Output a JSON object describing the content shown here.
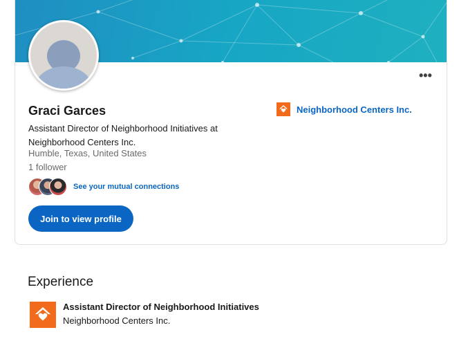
{
  "profile": {
    "name": "Graci Garces",
    "headline": "Assistant Director of Neighborhood Initiatives at Neighborhood Centers Inc.",
    "location": "Humble, Texas, United States",
    "followers": "1 follower",
    "mutual_link": "See your mutual connections",
    "join_label": "Join to view profile",
    "more_label": "•••"
  },
  "current_company": {
    "name": "Neighborhood Centers Inc.",
    "logo_icon": "house-heart-icon"
  },
  "experience": {
    "title": "Experience",
    "items": [
      {
        "role": "Assistant Director of Neighborhood Initiatives",
        "company": "Neighborhood Centers Inc."
      }
    ]
  },
  "colors": {
    "brand_blue": "#0a66c2",
    "company_orange": "#f26b1d",
    "banner_teal": "#17a6c4"
  }
}
